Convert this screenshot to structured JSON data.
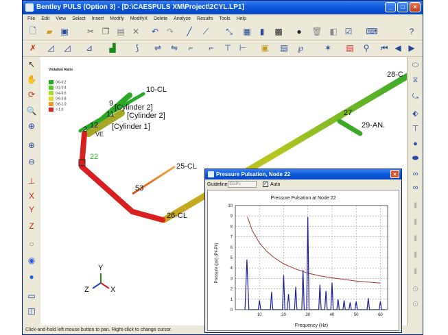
{
  "window": {
    "title": "Bentley PULS (Option 3) - [D:\\CAESPULS XM\\Project\\2CYL.LP1]"
  },
  "menu": [
    "File",
    "Edit",
    "View",
    "Select",
    "Insert",
    "Modify",
    "ModifyX",
    "Delete",
    "Analyze",
    "Results",
    "Tools",
    "Help"
  ],
  "legend": {
    "title": "Violation Ratio",
    "items": [
      {
        "label": "0.0-0.2",
        "color": "#22aa22"
      },
      {
        "label": "0.2-0.4",
        "color": "#55cc22"
      },
      {
        "label": "0.4-0.6",
        "color": "#aadd22"
      },
      {
        "label": "0.6-0.8",
        "color": "#dddd22"
      },
      {
        "label": "0.8-1.0",
        "color": "#ee9922"
      },
      {
        "label": "> 1.0",
        "color": "#dd2222"
      }
    ]
  },
  "nodes": {
    "n10": "10-CL",
    "n9": "9",
    "n11": "11",
    "n12": "12",
    "n2": "2",
    "n22": "22",
    "n25": "25-CL",
    "n53": "53",
    "n26": "26-CL",
    "n27": "27",
    "n29": "29-AN.",
    "n28": "28-C",
    "cyl2": "[Cylinder 2]",
    "cyl1": "[Cylinder 1]",
    "cylb": "[Cylinder 2]",
    "ve": "VE"
  },
  "axes": {
    "y": "Y",
    "z": "Z",
    "x": "X"
  },
  "status": "Click-and-hold left mouse button to pan.  Right-click to change cursor.",
  "dialog": {
    "title": "Pressure Pulsation, Node 22",
    "guideline_label": "Guideline",
    "guideline_value": "EDPL",
    "auto_label": "Auto",
    "auto_checked": true
  },
  "chart_data": {
    "type": "line",
    "title": "Pressure Pulsation at Node 22",
    "xlabel": "Frequency (Hz)",
    "ylabel": "Pressure (psi) (Pk-Pk)",
    "xlim": [
      0,
      63
    ],
    "ylim": [
      0,
      10
    ],
    "xticks": [
      10,
      20,
      30,
      40,
      50,
      60
    ],
    "yticks": [
      0,
      1,
      2,
      3,
      4,
      5,
      6,
      7,
      8,
      9,
      10
    ],
    "grid": true,
    "series": [
      {
        "color": "#a0342c",
        "x": [
          5,
          7,
          10,
          13,
          16,
          20,
          25,
          30,
          35,
          40,
          45,
          50,
          55,
          60
        ],
        "y": [
          8.9,
          7.6,
          6.4,
          5.6,
          5.0,
          4.4,
          3.9,
          3.5,
          3.25,
          3.05,
          2.9,
          2.75,
          2.65,
          2.55
        ]
      },
      {
        "color": "#1c1c9e",
        "x": [
          4.0,
          4.8,
          5.6,
          9.5,
          10.0,
          10.5,
          14.5,
          15.0,
          15.5,
          19.5,
          20.0,
          20.5,
          21.5,
          22.0,
          22.5,
          24.5,
          25.0,
          25.5,
          27.5,
          28.0,
          28.5,
          29.5,
          30.0,
          30.5,
          34.5,
          35.0,
          35.5,
          37.0,
          37.5,
          38.0,
          39.5,
          40.0,
          40.5,
          42.0,
          42.5,
          43.0,
          44.5,
          45.0,
          45.5,
          47.0,
          47.5,
          48.0,
          49.5,
          50.0,
          50.5,
          54.5,
          55.0,
          55.5,
          59.5,
          60.0,
          60.5,
          62.0
        ],
        "y": [
          0.0,
          4.8,
          0.0,
          0.0,
          0.9,
          0.0,
          0.0,
          1.7,
          0.0,
          0.0,
          3.3,
          0.0,
          0.0,
          1.5,
          0.0,
          0.0,
          2.2,
          0.0,
          0.0,
          3.8,
          0.0,
          0.0,
          8.9,
          0.0,
          0.0,
          2.4,
          0.0,
          0.0,
          1.8,
          0.0,
          0.0,
          2.6,
          0.0,
          0.0,
          1.0,
          0.0,
          0.0,
          0.9,
          0.0,
          0.0,
          0.7,
          0.0,
          0.0,
          0.8,
          0.0,
          0.0,
          1.1,
          0.0,
          0.0,
          0.8,
          0.0,
          0.0
        ]
      }
    ]
  }
}
